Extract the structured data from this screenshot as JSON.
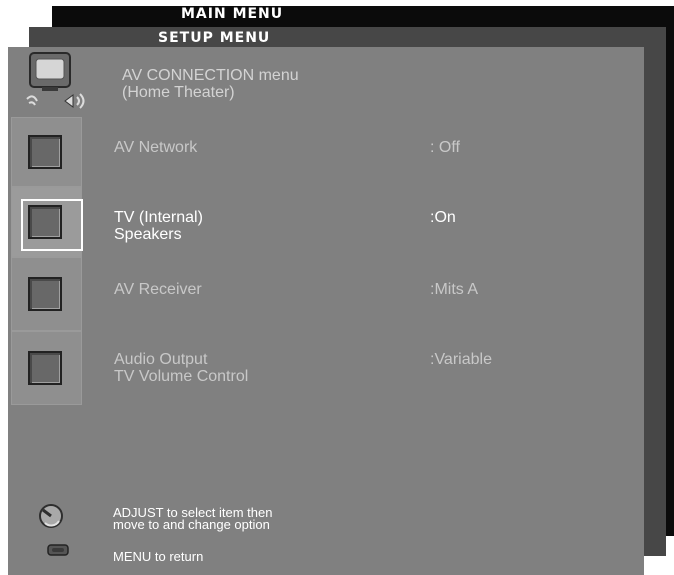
{
  "menus": {
    "main_title": "MAIN MENU",
    "setup_title": "SETUP MENU"
  },
  "header": {
    "label": "AV CONNECTION menu\n(Home Theater)"
  },
  "rows": [
    {
      "label": "AV Network",
      "value": ": Off"
    },
    {
      "label": "TV (Internal)\nSpeakers",
      "value": ":On"
    },
    {
      "label": "AV Receiver",
      "value": ":Mits A"
    },
    {
      "label": "Audio Output\nTV Volume Control",
      "value": ":Variable"
    }
  ],
  "footer": {
    "adjust_hint": "ADJUST to select item then\nmove to and change option",
    "return_hint": "MENU to return"
  },
  "icons": {
    "header": "tv-speakers-icon",
    "row": "square-option-icon",
    "adjust": "adjust-knob-icon",
    "menu": "menu-button-icon"
  },
  "colors": {
    "panel": "#808080",
    "selected_text": "#ffffff",
    "dim_text": "#c8c8c8"
  }
}
